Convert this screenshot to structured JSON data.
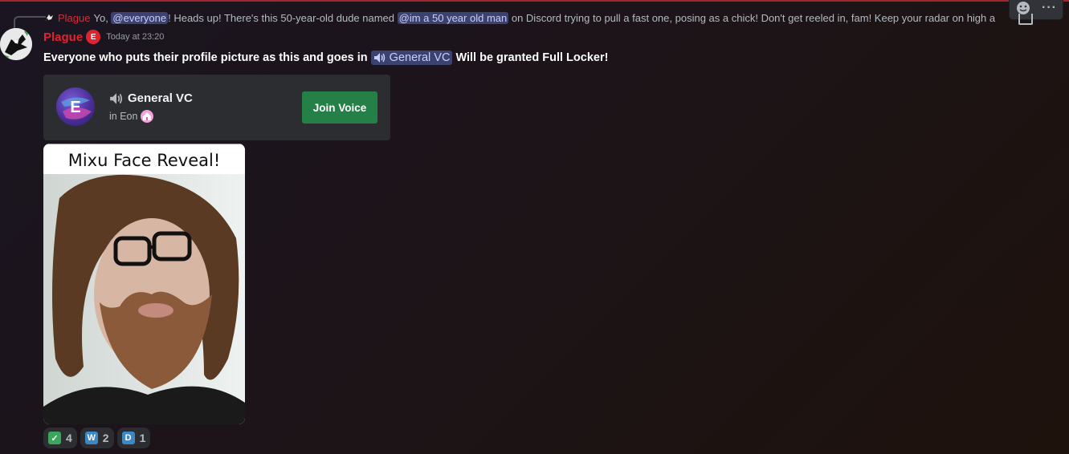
{
  "reply": {
    "username": "Plague",
    "text_before": "Yo, ",
    "mention_everyone": "@everyone",
    "text_middle": "! Heads up! There's this 50-year-old dude named ",
    "mention_user": "@im a 50 year old man",
    "text_after": " on Discord trying to pull a fast one, posing as a chick! Don't get reeled in, fam! Keep your radar on high a"
  },
  "message": {
    "username": "Plague",
    "timestamp": "Today at 23:20",
    "text_before": "Everyone who puts their profile picture as this and goes in",
    "channel_mention": "General VC",
    "text_after": "Will be granted Full Locker!"
  },
  "embed": {
    "channel_name": "General VC",
    "server_prefix": "in Eon",
    "join_label": "Join Voice"
  },
  "attachment": {
    "caption": "Mixu Face Reveal!"
  },
  "reactions": [
    {
      "emoji": "check-mark",
      "symbol": "✓",
      "color": "#3ba55c",
      "count": "4"
    },
    {
      "emoji": "letter-w",
      "symbol": "W",
      "color": "#3b88c3",
      "count": "2"
    },
    {
      "emoji": "letter-d",
      "symbol": "D",
      "color": "#3b88c3",
      "count": "1"
    }
  ],
  "toolbar": {
    "more_label": "···"
  },
  "colors": {
    "accent_red": "#e0242f",
    "join_green": "#248046",
    "mention_bg": "#3c4270"
  }
}
